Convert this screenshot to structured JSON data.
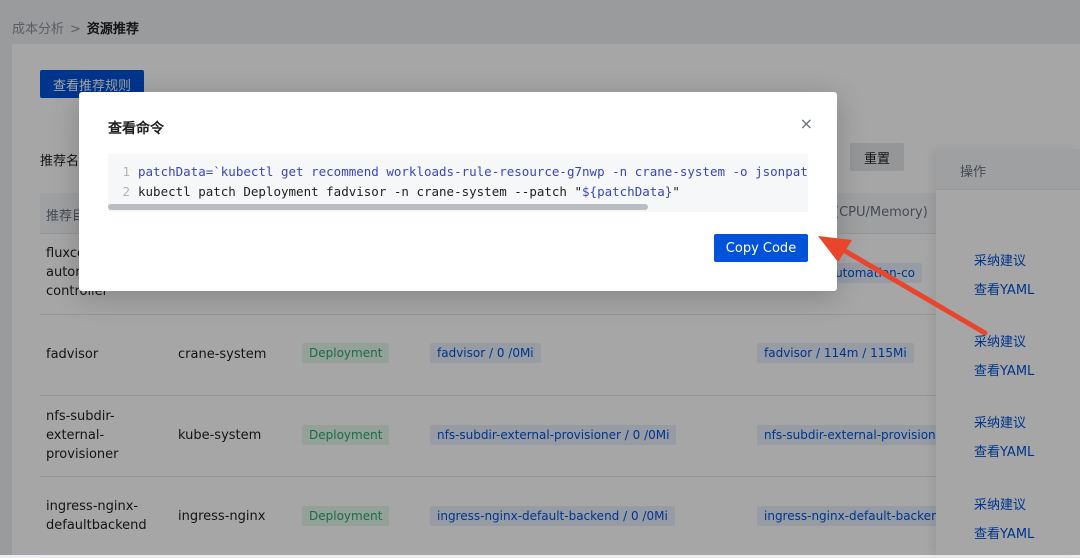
{
  "breadcrumb": {
    "parent": "成本分析",
    "separator": ">",
    "current": "资源推荐"
  },
  "toolbar": {
    "view_rules_label": "查看推荐规则",
    "reset_label": "重置",
    "filter_label": "推荐名"
  },
  "table": {
    "headers": {
      "target": "推荐目",
      "current_resources": "(CPU/Memory)",
      "ops": "操作"
    },
    "rows": [
      {
        "name_lines": [
          "fluxco",
          "autom",
          "controller"
        ],
        "namespace": "",
        "kind": "",
        "current": "",
        "recommended": "e-automation-co",
        "op_accept": "采纳建议",
        "op_yaml": "查看YAML"
      },
      {
        "name_lines": [
          "fadvisor"
        ],
        "namespace": "crane-system",
        "kind": "Deployment",
        "current": "fadvisor / 0 /0Mi",
        "recommended": "fadvisor / 114m / 115Mi",
        "op_accept": "采纳建议",
        "op_yaml": "查看YAML"
      },
      {
        "name_lines": [
          "nfs-subdir-",
          "external-",
          "provisioner"
        ],
        "namespace": "kube-system",
        "kind": "Deployment",
        "current": "nfs-subdir-external-provisioner / 0 /0Mi",
        "recommended": "nfs-subdir-external-provision",
        "op_accept": "采纳建议",
        "op_yaml": "查看YAML"
      },
      {
        "name_lines": [
          "ingress-nginx-",
          "defaultbackend"
        ],
        "namespace": "ingress-nginx",
        "kind": "Deployment",
        "current": "ingress-nginx-default-backend / 0 /0Mi",
        "recommended": "ingress-nginx-default-backer",
        "op_accept": "采纳建议",
        "op_yaml": "查看YAML"
      }
    ]
  },
  "dialog": {
    "title": "查看命令",
    "close_glyph": "×",
    "code": {
      "line1_no": "1",
      "line1_a": "patchData=`kubectl get recommend workloads-rule-resource-g7nwp -n crane-system -o jsonpath='{.st",
      "line2_no": "2",
      "line2_a": "kubectl patch Deployment fadvisor -n crane-system --patch \"",
      "line2_b": "${patchData}",
      "line2_c": "\""
    },
    "copy_label": "Copy Code"
  },
  "colors": {
    "primary": "#0052d9",
    "success": "#2ba471",
    "annotation_arrow": "#e8452c"
  }
}
